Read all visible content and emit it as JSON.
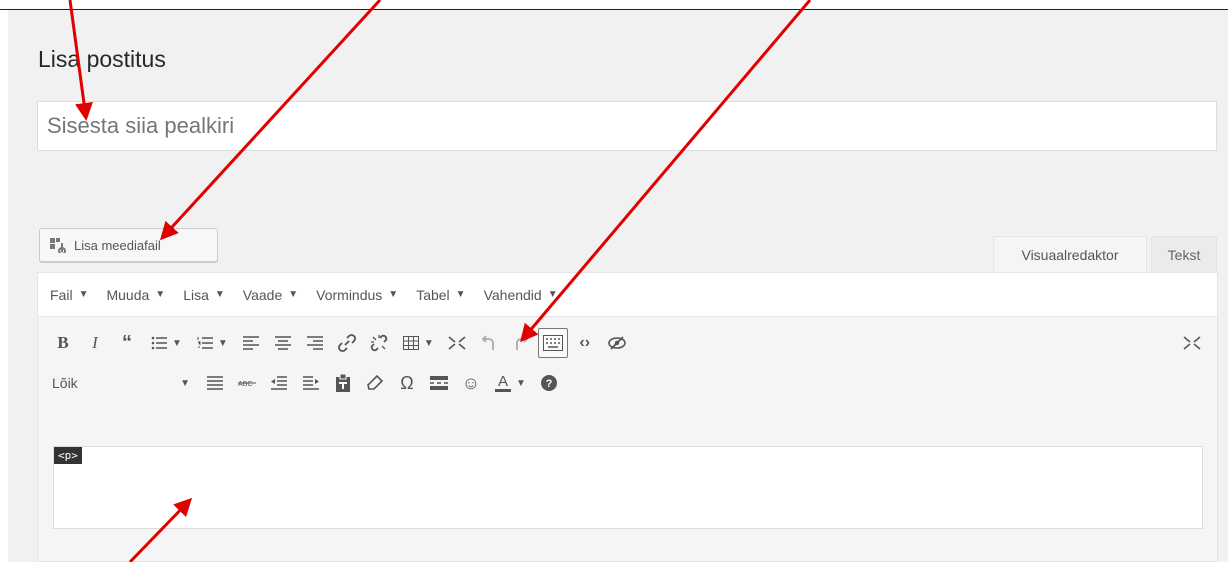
{
  "page": {
    "title": "Lisa postitus"
  },
  "title_field": {
    "placeholder": "Sisesta siia pealkiri",
    "value": ""
  },
  "media_button": {
    "label": "Lisa meediafail",
    "icon": "media-add-icon"
  },
  "editor_tabs": [
    {
      "label": "Visuaalredaktor",
      "active": true
    },
    {
      "label": "Tekst",
      "active": false
    }
  ],
  "menubar": [
    "Fail",
    "Muuda",
    "Lisa",
    "Vaade",
    "Vormindus",
    "Tabel",
    "Vahendid"
  ],
  "toolbar": {
    "row1": [
      "bold-icon",
      "italic-icon",
      "blockquote-icon",
      "bullet-list-icon",
      "numbered-list-icon",
      "align-left-icon",
      "align-center-icon",
      "align-right-icon",
      "link-icon",
      "unlink-icon",
      "table-icon",
      "fullscreen-icon",
      "undo-icon",
      "redo-icon",
      "keyboard-toggle-icon",
      "code-icon",
      "hide-icon",
      "fullscreen-icon"
    ],
    "row2": [
      "align-justify-icon",
      "strikethrough-icon",
      "outdent-icon",
      "indent-icon",
      "paste-text-icon",
      "clear-format-icon",
      "special-char-icon",
      "read-more-icon",
      "emoji-icon",
      "text-color-icon",
      "help-icon"
    ],
    "format_select": "Lõik"
  },
  "content": {
    "current_tag": "<p>"
  },
  "colors": {
    "arrow": "#e00000",
    "page_bg": "#f1f1f1",
    "toolbar_bg": "#ffffff"
  }
}
